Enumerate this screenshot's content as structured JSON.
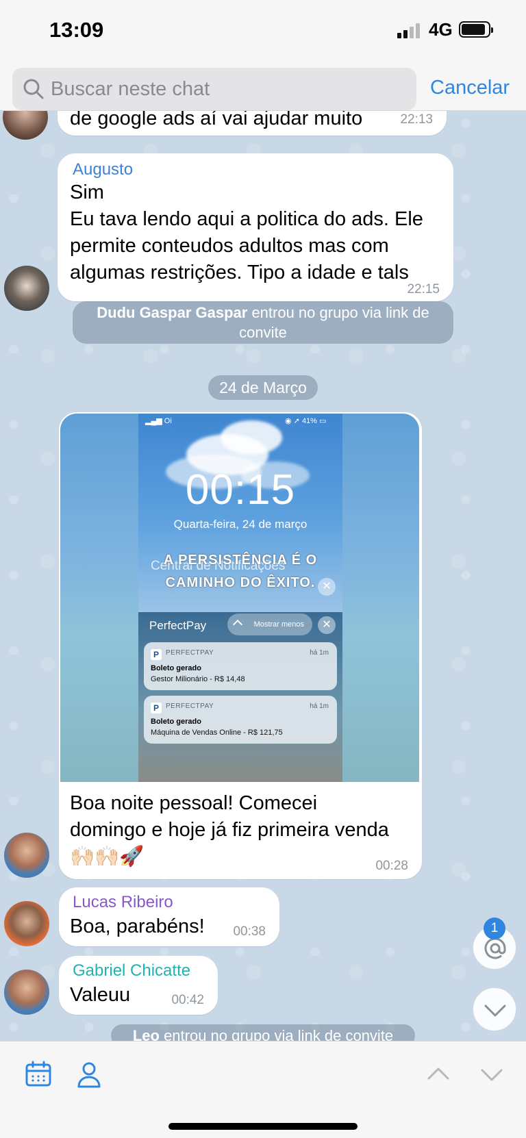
{
  "status_bar": {
    "time": "13:09",
    "network": "4G"
  },
  "search": {
    "placeholder": "Buscar neste chat",
    "cancel_label": "Cancelar"
  },
  "messages": {
    "partial": {
      "text": "de google ads aí vai ajudar muito",
      "time": "22:13"
    },
    "augusto": {
      "sender": "Augusto",
      "lines": [
        "Sim",
        "Eu tava lendo aqui a politica do ads. Ele",
        "permite conteudos adultos mas com",
        "algumas restrições. Tipo a idade e tals"
      ],
      "time": "22:15",
      "sender_color": "#3e80d8"
    },
    "system_join_1": {
      "name": "Dudu Gaspar Gaspar",
      "line1": " entrou no grupo via link de",
      "line2": "convite"
    },
    "date_separator": "24 de Março",
    "photo_message": {
      "screenshot": {
        "carrier": "Oi",
        "battery": "41%",
        "lock_time": "00:15",
        "lock_date": "Quarta-feira, 24 de março",
        "quote_line1": "A PERSISTÊNCIA É O",
        "quote_line2": "CAMINHO DO ÊXITO.",
        "center_label": "Central de Notificações",
        "app_group": "PerfectPay",
        "show_less": "Mostrar menos",
        "notifications": [
          {
            "app": "PERFECTPAY",
            "when": "há 1m",
            "title": "Boleto gerado",
            "body": "Gestor Milionário - R$ 14,48"
          },
          {
            "app": "PERFECTPAY",
            "when": "há 1m",
            "title": "Boleto gerado",
            "body": "Máquina de Vendas Online  - R$ 121,75"
          }
        ]
      },
      "lines": [
        "Boa noite pessoal! Comecei",
        "domingo e hoje já fiz primeira venda",
        "🙌🏻🙌🏻🚀"
      ],
      "time": "00:28"
    },
    "lucas": {
      "sender": "Lucas Ribeiro",
      "text": "Boa, parabéns!",
      "time": "00:38",
      "sender_color": "#8a56cf"
    },
    "gabriel": {
      "sender": "Gabriel Chicatte",
      "text": "Valeuu",
      "time": "00:42",
      "sender_color": "#1fb3b0"
    },
    "system_join_2": {
      "name": "Leo",
      "line1": " entrou no grupo via link de convite"
    }
  },
  "mentions": {
    "count": "1"
  },
  "icons": [
    "search-icon",
    "at-icon",
    "chevron-down-icon",
    "calendar-icon",
    "user-icon",
    "chevron-up-icon"
  ],
  "colors": {
    "accent": "#2f86e0",
    "chat_background": "#c9d8e6"
  }
}
